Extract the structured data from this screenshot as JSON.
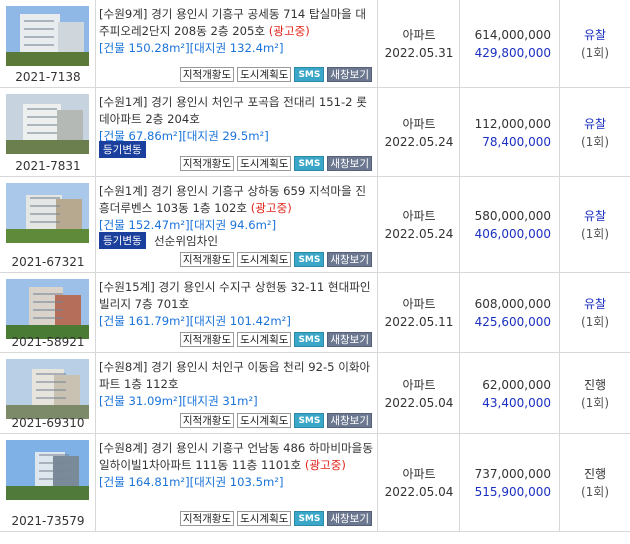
{
  "labels": {
    "area_prefix": "[건물 ",
    "area_mid": "][대지권 ",
    "area_suffix": "]",
    "btn_jijeok": "지적개황도",
    "btn_dosi": "도시계획도",
    "btn_sms": "SMS",
    "btn_saeng": "새창보기"
  },
  "listings": [
    {
      "case_no": "2021-7138",
      "addr": "[수원9계] 경기 용인시 기흥구 공세동 714 탑실마을 대주피오레2단지 208동 2층 205호",
      "ad_tag": "(광고중)",
      "bldg": "150.28m²",
      "land": "132.4m²",
      "type": "아파트",
      "date": "2022.05.31",
      "appraisal": "614,000,000",
      "min_price": "429,800,000",
      "status": "유찰",
      "count": "(1회)",
      "reg_tag": "",
      "reg_text": ""
    },
    {
      "case_no": "2021-7831",
      "addr": "[수원1계] 경기 용인시 처인구 포곡읍 전대리 151-2 롯데아파트 2층 204호",
      "ad_tag": "",
      "bldg": "67.86m²",
      "land": "29.5m²",
      "type": "아파트",
      "date": "2022.05.24",
      "appraisal": "112,000,000",
      "min_price": "78,400,000",
      "status": "유찰",
      "count": "(1회)",
      "reg_tag": "등기변동",
      "reg_text": ""
    },
    {
      "case_no": "2021-67321",
      "addr": "[수원1계] 경기 용인시 기흥구 상하동 659 지석마을 진흥더루벤스 103동 1층 102호",
      "ad_tag": "(광고중)",
      "bldg": "152.47m²",
      "land": "94.6m²",
      "type": "아파트",
      "date": "2022.05.24",
      "appraisal": "580,000,000",
      "min_price": "406,000,000",
      "status": "유찰",
      "count": "(1회)",
      "reg_tag": "등기변동",
      "reg_text": "선순위임차인"
    },
    {
      "case_no": "2021-58921",
      "addr": "[수원15계] 경기 용인시 수지구 상현동 32-11 현대파인빌리지 7층 701호",
      "ad_tag": "",
      "bldg": "161.79m²",
      "land": "101.42m²",
      "type": "아파트",
      "date": "2022.05.11",
      "appraisal": "608,000,000",
      "min_price": "425,600,000",
      "status": "유찰",
      "count": "(1회)",
      "reg_tag": "",
      "reg_text": ""
    },
    {
      "case_no": "2021-69310",
      "addr": "[수원8계] 경기 용인시 처인구 이동읍 천리 92-5 이화아파트 1층 112호",
      "ad_tag": "",
      "bldg": "31.09m²",
      "land": "31m²",
      "type": "아파트",
      "date": "2022.05.04",
      "appraisal": "62,000,000",
      "min_price": "43,400,000",
      "status": "진행",
      "count": "(1회)",
      "reg_tag": "",
      "reg_text": ""
    },
    {
      "case_no": "2021-73579",
      "addr": "[수원8계] 경기 용인시 기흥구 언남동 486 하마비마을동일하이빌1차아파트 111동 11층 1101호",
      "ad_tag": "(광고중)",
      "bldg": "164.81m²",
      "land": "103.5m²",
      "type": "아파트",
      "date": "2022.05.04",
      "appraisal": "737,000,000",
      "min_price": "515,900,000",
      "status": "진행",
      "count": "(1회)",
      "reg_tag": "",
      "reg_text": ""
    }
  ]
}
